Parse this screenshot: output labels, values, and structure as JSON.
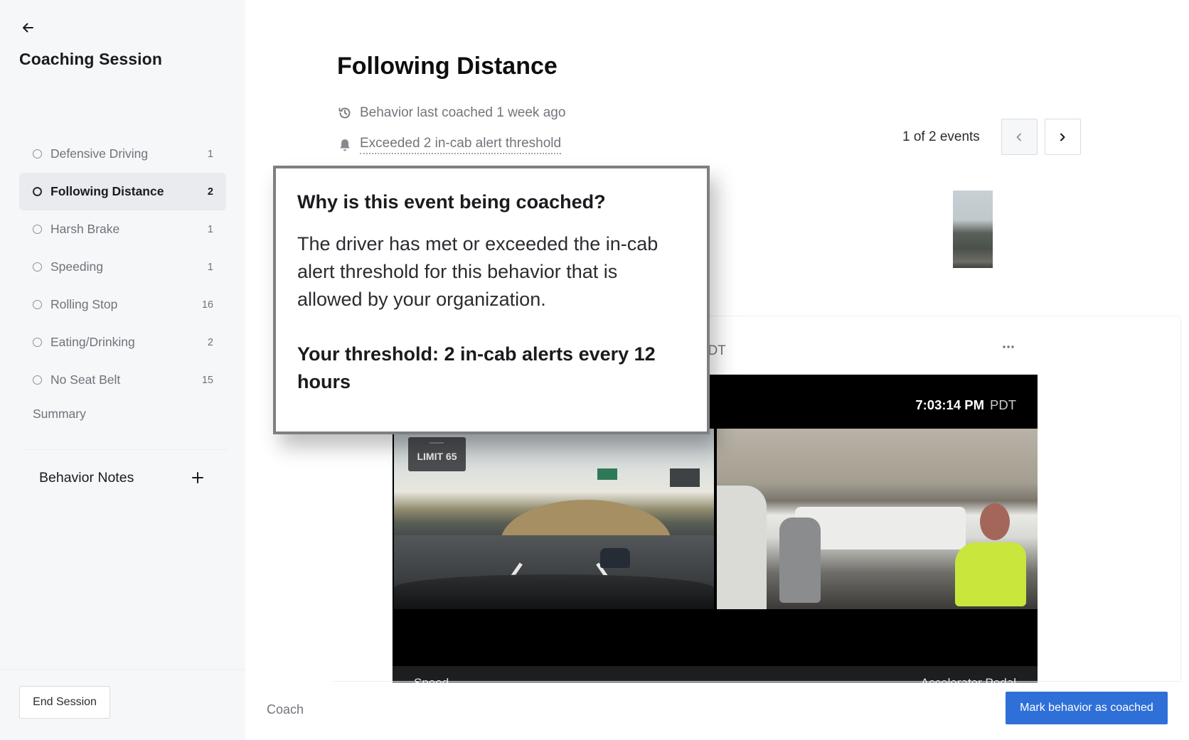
{
  "sidebar": {
    "back_icon": "arrow-left-icon",
    "title": "Coaching Session",
    "behaviors": [
      {
        "label": "Defensive Driving",
        "count": "1",
        "active": false
      },
      {
        "label": "Following Distance",
        "count": "2",
        "active": true
      },
      {
        "label": "Harsh Brake",
        "count": "1",
        "active": false
      },
      {
        "label": "Speeding",
        "count": "1",
        "active": false
      },
      {
        "label": "Rolling Stop",
        "count": "16",
        "active": false
      },
      {
        "label": "Eating/Drinking",
        "count": "2",
        "active": false
      },
      {
        "label": "No Seat Belt",
        "count": "15",
        "active": false
      }
    ],
    "summary_label": "Summary",
    "notes_title": "Behavior Notes",
    "add_note_icon": "plus-icon",
    "end_session_label": "End Session"
  },
  "main": {
    "title": "Following Distance",
    "last_coached": "Behavior last coached 1 week ago",
    "last_coached_icon": "history-icon",
    "threshold_link": "Exceeded 2 in-cab alert threshold",
    "threshold_icon": "bell-icon",
    "pager": {
      "text": "1 of 2 events",
      "prev_icon": "chevron-left-icon",
      "next_icon": "chevron-right-icon",
      "prev_disabled": true
    },
    "event": {
      "time_partial": "PM PDT",
      "more_icon": "ellipsis-icon",
      "video": {
        "timestamp": "7:03:14 PM",
        "timezone": "PDT",
        "speed_limit": "LIMIT 65",
        "data_left": "Speed",
        "data_right": "Accelerator Pedal"
      }
    },
    "footer": {
      "coach_label": "Coach",
      "mark_coached_label": "Mark behavior as coached"
    }
  },
  "popover": {
    "title": "Why is this event being coached?",
    "body": "The driver has met or exceeded the in-cab alert threshold for this behavior that is allowed by your organization.",
    "threshold": "Your threshold: 2 in-cab alerts every 12 hours"
  },
  "colors": {
    "primary": "#2f6fd8",
    "sidebar_bg": "#f5f7f9",
    "active_item_bg": "#e9ebee",
    "muted_text": "#71757b"
  }
}
